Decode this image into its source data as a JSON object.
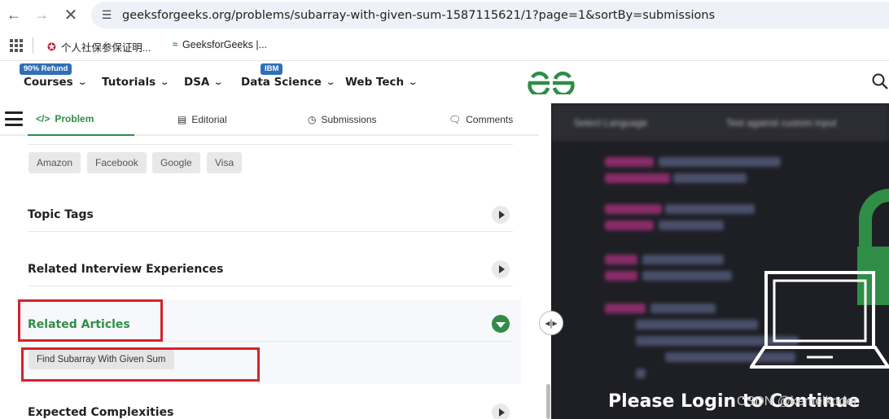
{
  "browser": {
    "url": "geeksforgeeks.org/problems/subarray-with-given-sum-1587115621/1?page=1&sortBy=submissions",
    "bookmarks": [
      {
        "label": "个人社保参保证明..."
      },
      {
        "label": "GeeksforGeeks |..."
      }
    ]
  },
  "header": {
    "menu": [
      {
        "label": "Courses",
        "badge": "90% Refund"
      },
      {
        "label": "Tutorials"
      },
      {
        "label": "DSA"
      },
      {
        "label": "Data Science",
        "badge": "IBM"
      },
      {
        "label": "Web Tech"
      }
    ]
  },
  "tabs": [
    {
      "label": "Problem",
      "active": true
    },
    {
      "label": "Editorial"
    },
    {
      "label": "Submissions"
    },
    {
      "label": "Comments"
    }
  ],
  "company_tags": [
    "Amazon",
    "Facebook",
    "Google",
    "Visa"
  ],
  "sections": {
    "topic_tags": "Topic Tags",
    "related_interview": "Related Interview Experiences",
    "related_articles": "Related Articles",
    "expected_complexities": "Expected Complexities"
  },
  "related_articles": [
    "Find Subarray With Given Sum"
  ],
  "editor": {
    "toolbar_language": "Select Language",
    "toolbar_custom": "Test against custom input",
    "login_message": "Please Login to Continue"
  },
  "watermark": "CSDN @kemelkoder",
  "colors": {
    "brand_green": "#2f8d46",
    "highlight_red": "#d4222b"
  }
}
